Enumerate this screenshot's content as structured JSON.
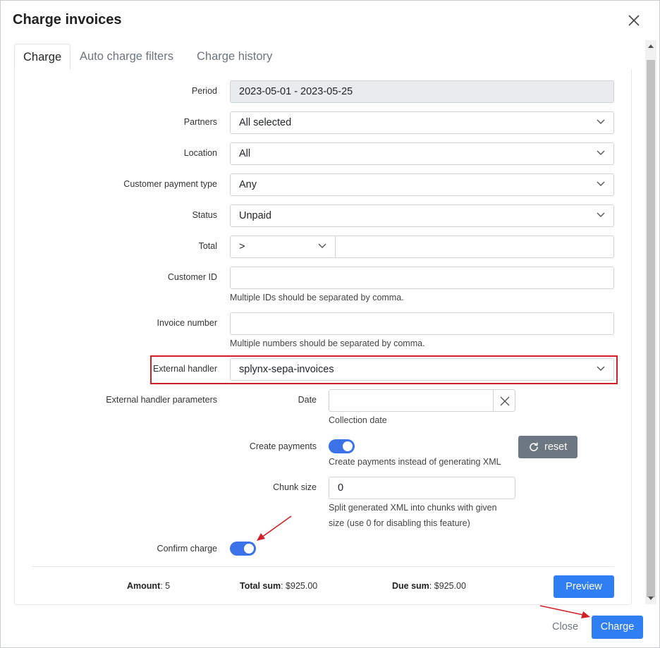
{
  "dialog": {
    "title": "Charge invoices"
  },
  "tabs": [
    {
      "label": "Charge",
      "active": true
    },
    {
      "label": "Auto charge filters",
      "active": false
    },
    {
      "label": "Charge history",
      "active": false
    }
  ],
  "form": {
    "period": {
      "label": "Period",
      "value": "2023-05-01 - 2023-05-25"
    },
    "partners": {
      "label": "Partners",
      "value": "All selected"
    },
    "location": {
      "label": "Location",
      "value": "All"
    },
    "customer_payment_type": {
      "label": "Customer payment type",
      "value": "Any"
    },
    "status": {
      "label": "Status",
      "value": "Unpaid"
    },
    "total": {
      "label": "Total",
      "operator": ">",
      "value": ""
    },
    "customer_id": {
      "label": "Customer ID",
      "value": "",
      "help": "Multiple IDs should be separated by comma."
    },
    "invoice_number": {
      "label": "Invoice number",
      "value": "",
      "help": "Multiple numbers should be separated by comma."
    },
    "external_handler": {
      "label": "External handler",
      "value": "splynx-sepa-invoices"
    },
    "external_handler_parameters": {
      "label": "External handler parameters",
      "date": {
        "label": "Date",
        "value": "",
        "help": "Collection date"
      },
      "create_payments": {
        "label": "Create payments",
        "enabled": true,
        "help": "Create payments instead of generating XML"
      },
      "reset_label": "reset",
      "chunk_size": {
        "label": "Chunk size",
        "value": "0",
        "help_line1": "Split generated XML into chunks with given",
        "help_line2": "size (use 0 for disabling this feature)"
      }
    },
    "confirm_charge": {
      "label": "Confirm charge",
      "enabled": true
    }
  },
  "summary": {
    "amount_label": "Amount",
    "amount_value": ": 5",
    "total_label": "Total sum",
    "total_value": ": $925.00",
    "due_label": "Due sum",
    "due_value": ": $925.00",
    "preview_label": "Preview"
  },
  "footer": {
    "close_label": "Close",
    "charge_label": "Charge"
  },
  "colors": {
    "primary": "#2f7ef3",
    "toggle": "#3b72e8",
    "highlight": "#d32027",
    "reset_button": "#6c7781"
  },
  "icons": {
    "close": "close-icon",
    "chevron": "chevron-down-icon",
    "reset": "refresh-icon",
    "clear": "close-icon"
  }
}
